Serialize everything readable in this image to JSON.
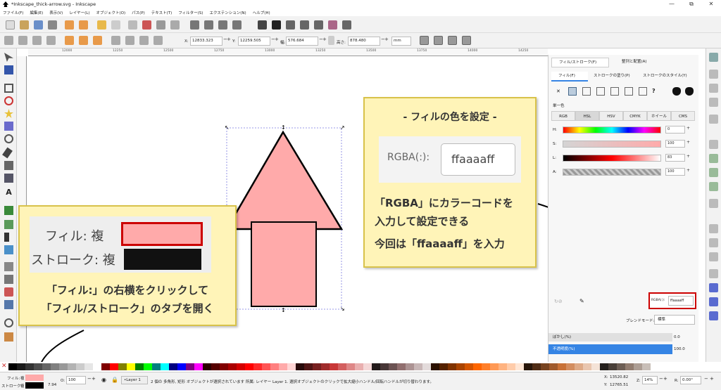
{
  "window": {
    "title": "*Inkscape_thick-arrow.svg - Inkscape",
    "min": "—",
    "max": "⧉",
    "close": "✕"
  },
  "menu": [
    "ファイル(F)",
    "編集(E)",
    "表示(V)",
    "レイヤー(L)",
    "オブジェクト(O)",
    "パス(P)",
    "テキスト(T)",
    "フィルター(S)",
    "エクステンション(N)",
    "ヘルプ(H)"
  ],
  "controls": {
    "x_label": "X:",
    "x_value": "12833.323",
    "y_label": "Y:",
    "y_value": "12259.505",
    "w_label": "幅:",
    "w_value": "576.684",
    "h_label": "高さ:",
    "h_value": "878.480",
    "unit": "mm",
    "plus": "+",
    "minus": "−"
  },
  "ruler": [
    "12000",
    "12250",
    "12500",
    "12750",
    "13000",
    "13250",
    "13500",
    "13750",
    "14000",
    "14250"
  ],
  "dock": {
    "tab_fill_stroke": "フィル/ストローク(F)",
    "tab_align": "整列と配置(A)",
    "sub_fill": "フィル(F)",
    "sub_stroke_paint": "ストロークの塗り(P)",
    "sub_stroke_style": "ストロークのスタイル(Y)",
    "flat_color": "単一色",
    "color_tabs": [
      "RGB",
      "HSL",
      "HSV",
      "CMYK",
      "ホイール",
      "CMS"
    ],
    "sliders": [
      {
        "label": "H:",
        "value": "0"
      },
      {
        "label": "S:",
        "value": "100"
      },
      {
        "label": "L:",
        "value": "83"
      },
      {
        "label": "A:",
        "value": "100"
      }
    ],
    "rgba_label": "RGBA(:):",
    "rgba_value": "ffaaaaff",
    "blend_label": "ブレンドモード:",
    "blend_value": "標準",
    "blur_label": "ぼかし(%)",
    "blur_value": "0.0",
    "opacity_label": "不透明度(%)",
    "opacity_value": "100.0",
    "unknown_btn": "?"
  },
  "callouts": {
    "top_title": "- フィルの色を設定 -",
    "top_rgba_label": "RGBA(:):",
    "top_rgba_value": "ffaaaaff",
    "top_line1": "「RGBA」にカラーコードを",
    "top_line2": "入力して設定できる",
    "top_line3": "今回は「ffaaaaff」を入力",
    "left_fill": "フィル: 複",
    "left_stroke": "ストローク: 複",
    "left_line1": "「フィル:」の右横をクリックして",
    "left_line2": "「フィル/ストローク」のタブを開く"
  },
  "status": {
    "fill_label": "フィル:",
    "fill_value": "複",
    "stroke_label": "ストローク:",
    "stroke_value": "複",
    "stroke_width": "7.94",
    "opacity_label": "O:",
    "opacity_value": "100",
    "layer": "•Layer 1",
    "message": "2 個の 多角形, 矩形 オブジェクトが選択されています 所属: レイヤー Layer 1. 選択オブジェクトのクリックで拡大縮小ハンドル/回転ハンドルが切り替わります。",
    "x_label": "X:",
    "x_value": "13520.82",
    "y_label": "Y:",
    "y_value": "12765.51",
    "zoom_label": "Z:",
    "zoom_value": "14%",
    "rot_label": "R:",
    "rot_value": "0.00°"
  },
  "palette_colors": [
    "#000000",
    "#1a1a1a",
    "#333333",
    "#4d4d4d",
    "#666666",
    "#808080",
    "#999999",
    "#b3b3b3",
    "#cccccc",
    "#e6e6e6",
    "#ffffff",
    "#800000",
    "#ff0000",
    "#808000",
    "#ffff00",
    "#008000",
    "#00ff00",
    "#008080",
    "#00ffff",
    "#000080",
    "#0000ff",
    "#800080",
    "#ff00ff",
    "#2b0000",
    "#550000",
    "#800000",
    "#aa0000",
    "#d40000",
    "#ff0000",
    "#ff2a2a",
    "#ff5555",
    "#ff8080",
    "#ffaaaa",
    "#ffd5d5",
    "#280b0b",
    "#501616",
    "#782121",
    "#a02c2c",
    "#c83737",
    "#d35f5f",
    "#de8787",
    "#e9afaf",
    "#f4d7d7",
    "#241c1c",
    "#483737",
    "#6c5353",
    "#916f6f",
    "#ac9393",
    "#c8b7b7",
    "#e3dbdb",
    "#2b1100",
    "#552200",
    "#803300",
    "#aa4400",
    "#d45500",
    "#ff6600",
    "#ff7f2a",
    "#ff9955",
    "#ffb380",
    "#ffccaa",
    "#ffe6d5",
    "#28170b",
    "#502d16",
    "#784421",
    "#a05a2c",
    "#c87137",
    "#d38d5f",
    "#deaa87",
    "#e9c6af",
    "#f4e3d7",
    "#241f1c",
    "#483e37",
    "#6c5d53",
    "#917c6f",
    "#ac9d93",
    "#c8beb7"
  ],
  "colors": {
    "fill": "#ffaaaa",
    "accent": "#cc0000",
    "selection": "#3584e4"
  }
}
